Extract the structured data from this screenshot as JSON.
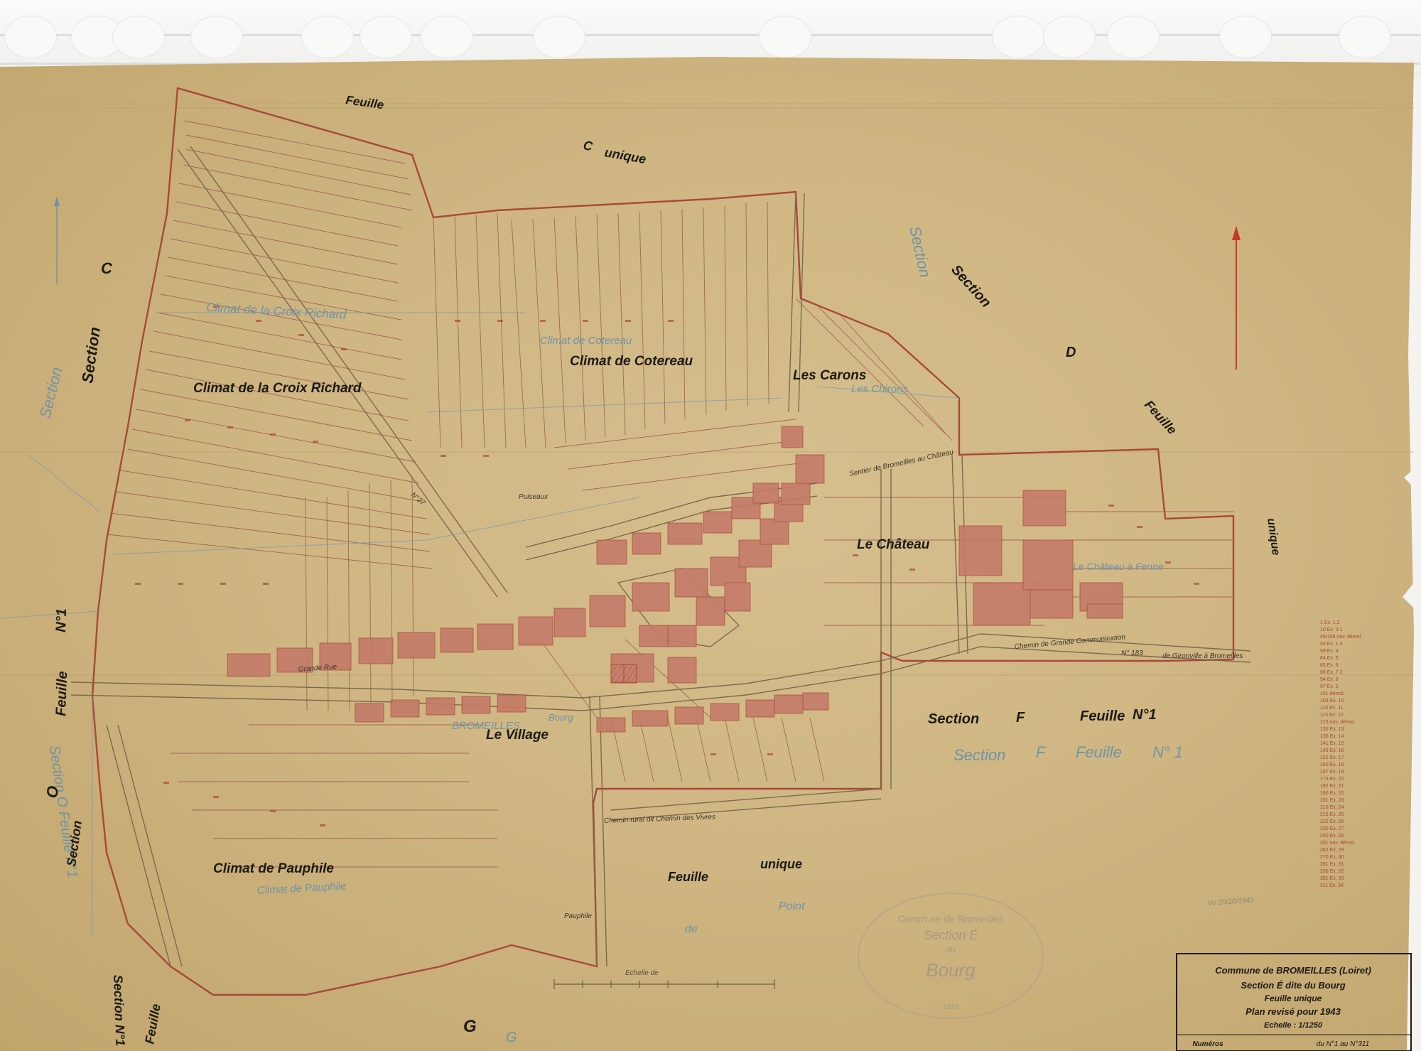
{
  "sheet_labels": {
    "feuille_top": "Feuille",
    "c_unique_c": "C",
    "c_unique_unique": "unique",
    "section_c_left_section": "Section",
    "section_c_left_c": "C",
    "section_c_blue": "Section",
    "section_d_blue": "Section",
    "section_d_section": "Section",
    "section_d_d": "D",
    "section_d_feuille": "Feuille",
    "section_d_unique": "unique",
    "section_o_feuille": "Feuille",
    "section_o_no": "N°1",
    "section_o_blue": "Section O Feuille n°1",
    "section_o_black": "Section",
    "section_o_o": "O",
    "section_n_bottom": "Section N°1",
    "section_n_feuille": "Feuille",
    "g_label": "G",
    "g_label_blue": "G",
    "feuille_unique_bottom_feuille": "Feuille",
    "feuille_unique_bottom_unique": "unique",
    "point": "Point",
    "de_bottom": "de"
  },
  "section_f": {
    "black": [
      "Section",
      "F",
      "Feuille",
      "N°1"
    ],
    "blue": [
      "Section",
      "F",
      "Feuille",
      "N° 1"
    ]
  },
  "places": {
    "climat_croix_richard": "Climat de la Croix Richard",
    "climat_croix_richard_blue": "Climat de la Croix Richard",
    "climat_cotereau": "Climat de Cotereau",
    "climat_cotereau_blue": "Climat de Cotereau",
    "les_carons": "Les Carons",
    "les_carons_blue": "Les Chirons",
    "le_chateau": "Le Château",
    "le_chateau_blue": "Le Château à Fenne",
    "le_village": "Le Village",
    "bromeilles_blue": "BROMEILLES",
    "bourg_blue": "Bourg",
    "climat_pauphile": "Climat de Pauphile",
    "climat_pauphile_blue": "Climat de Pauphile"
  },
  "roads": {
    "chemin_grande_communication": "Chemin de Grande Communication",
    "n183": "N° 183",
    "n27": "N°27",
    "rue_main": "Grande Rue",
    "gironville_bromeilles": "de Gironville à Bromeilles",
    "sentier_chateau": "Sentier de Bromeilles au Château",
    "chemin_vaivres": "Chemin rural dit Chemin des Vivres",
    "puiseaux": "Puiseaux",
    "pauphile": "Pauphile"
  },
  "stamp": {
    "line1": "Comm.ne de Bromeilles",
    "line2": "Section É",
    "line3": "du",
    "line4": "Bourg",
    "line5": "1834"
  },
  "scale_bar": {
    "label": "Echelle de"
  },
  "title_block": {
    "line1": "Commune de BROMEILLES (Loiret)",
    "line2": "Section É dite du Bourg",
    "line3": "Feuille unique",
    "line4": "Plan revisé pour 1943",
    "line5": "Echelle : 1/1250",
    "numeros_label": "Numéros",
    "numeros_range": "du N°1 au N°311"
  },
  "legend_notes": [
    "1 Ex. 1.2",
    "10 Ex. 3.1",
    "49/108 nov. démol.",
    "50 Ex. 1.3",
    "59 Ex. 4",
    "84 Ex. 5",
    "85 Ex. 6",
    "86 Ex. 7.2",
    "94 Ex. 8",
    "97 Ex. 9",
    "101 démol.",
    "103 Ex. 10",
    "110 Ex. 11",
    "115 Ex. 12",
    "123 nov. démol.",
    "130 Ex. 13",
    "136 Ex. 14",
    "141 Ex. 15",
    "149 Ex. 16",
    "152 Ex. 17",
    "160 Ex. 18",
    "167 Ex. 19",
    "173 Ex. 20",
    "182 Ex. 21",
    "190 Ex. 22",
    "201 Ex. 23",
    "210 Ex. 24",
    "215 Ex. 25",
    "222 Ex. 26",
    "230 Ex. 27",
    "240 Ex. 28",
    "251 nov. démol.",
    "262 Ex. 29",
    "270 Ex. 30",
    "281 Ex. 31",
    "290 Ex. 32",
    "301 Ex. 33",
    "311 Ex. 34"
  ],
  "pencil_note": "Vu 29/10/1943",
  "colors": {
    "paper": "#cfb682",
    "red_ink": "#a8483a",
    "blue_ink": "#6f93a6",
    "black_ink": "#1c1a15",
    "building_fill": "#c47b68"
  }
}
